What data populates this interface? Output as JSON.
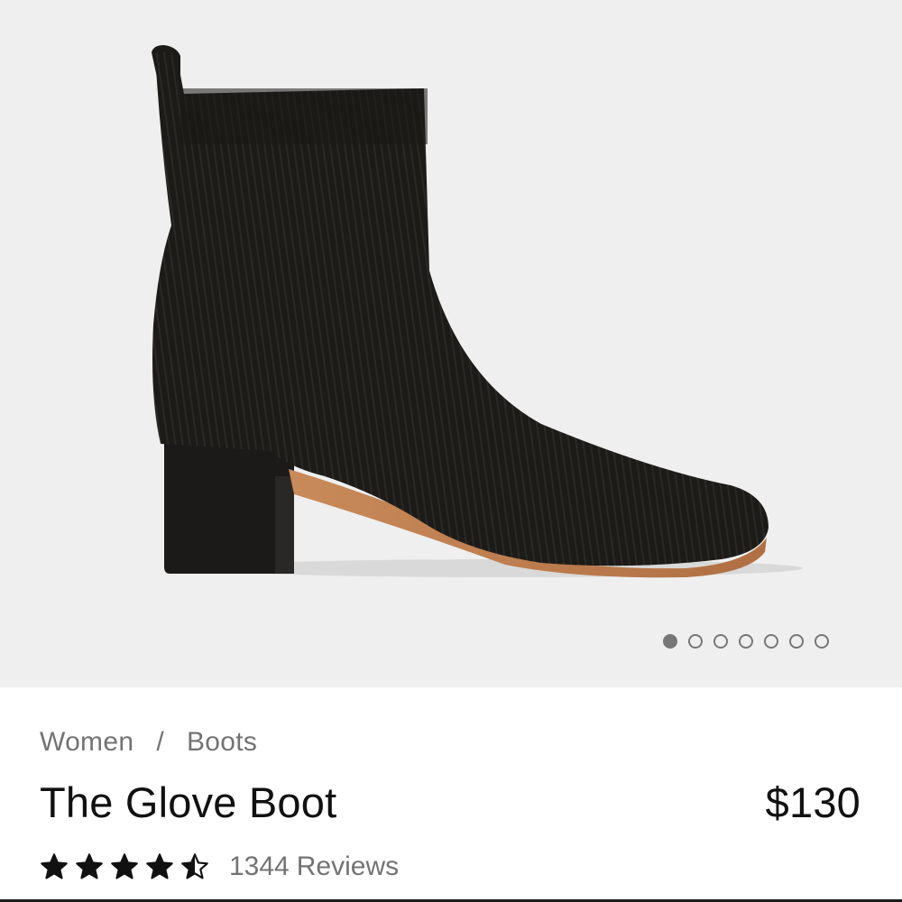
{
  "hero": {
    "image_name": "black knit ankle boot with stacked heel",
    "carousel": {
      "count": 7,
      "active_index": 0
    }
  },
  "breadcrumb": {
    "items": [
      "Women",
      "Boots"
    ],
    "separator": "/"
  },
  "product": {
    "title": "The Glove Boot",
    "price": "$130"
  },
  "rating": {
    "value": 4.5,
    "max": 5,
    "count": "1344",
    "label": "Reviews"
  },
  "colors": {
    "background_hero": "#efefef",
    "text_primary": "#111111",
    "text_muted": "#737373",
    "dot": "#777777"
  }
}
